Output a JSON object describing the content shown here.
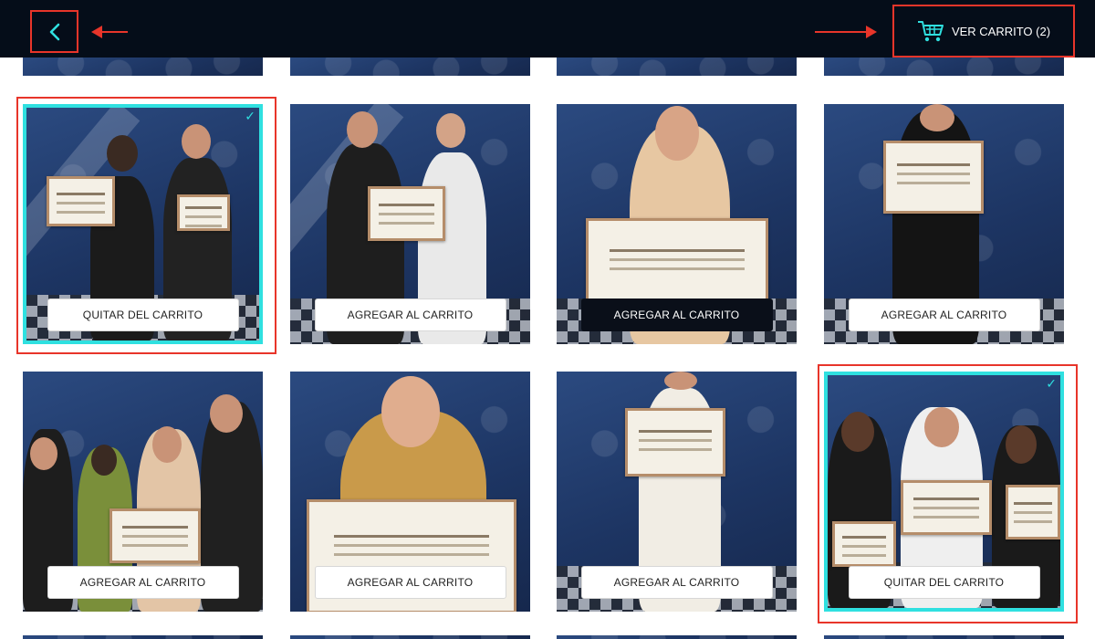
{
  "topbar": {
    "cart_label": "VER CARRITO (2)",
    "back_icon": "chevron-left-icon",
    "cart_icon": "shopping-cart-icon",
    "accent_color": "#2fe0e0",
    "annotation_color": "#e8352a"
  },
  "tiles": [
    {
      "button": "QUITAR DEL CARRITO",
      "selected": true
    },
    {
      "button": "AGREGAR AL CARRITO",
      "selected": false
    },
    {
      "button": "AGREGAR AL CARRITO",
      "selected": false
    },
    {
      "button": "AGREGAR AL CARRITO",
      "selected": false
    },
    {
      "button": "AGREGAR AL CARRITO",
      "selected": false
    },
    {
      "button": "AGREGAR AL CARRITO",
      "selected": false
    },
    {
      "button": "AGREGAR AL CARRITO",
      "selected": false
    },
    {
      "button": "QUITAR DEL CARRITO",
      "selected": true
    }
  ]
}
